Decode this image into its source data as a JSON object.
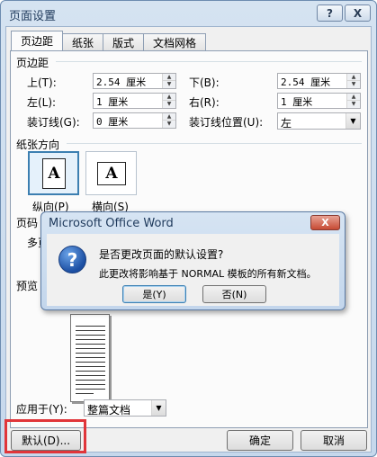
{
  "window": {
    "title": "页面设置",
    "help_label": "?",
    "close_label": "X"
  },
  "tabs": [
    {
      "label": "页边距",
      "active": true
    },
    {
      "label": "纸张",
      "active": false
    },
    {
      "label": "版式",
      "active": false
    },
    {
      "label": "文档网格",
      "active": false
    }
  ],
  "margins": {
    "section_label": "页边距",
    "top": {
      "label": "上(T):",
      "value": "2.54 厘米"
    },
    "bottom": {
      "label": "下(B):",
      "value": "2.54 厘米"
    },
    "left": {
      "label": "左(L):",
      "value": "1 厘米"
    },
    "right": {
      "label": "右(R):",
      "value": "1 厘米"
    },
    "gutter": {
      "label": "装订线(G):",
      "value": "0 厘米"
    },
    "gutter_pos": {
      "label": "装订线位置(U):",
      "value": "左"
    }
  },
  "orientation": {
    "section_label": "纸张方向",
    "portrait_label": "纵向(P)",
    "landscape_label": "横向(S)",
    "glyph": "A",
    "selected": "portrait"
  },
  "pages": {
    "section_label": "页码",
    "multi_label": "多页"
  },
  "preview": {
    "section_label": "预览",
    "apply_label": "应用于(Y):",
    "apply_value": "整篇文档"
  },
  "buttons": {
    "default_label": "默认(D)...",
    "ok_label": "确定",
    "cancel_label": "取消"
  },
  "dialog": {
    "title": "Microsoft Office Word",
    "close_label": "X",
    "icon_glyph": "?",
    "question": "是否更改页面的默认设置?",
    "detail": "此更改将影响基于 NORMAL 模板的所有新文档。",
    "yes_label": "是(Y)",
    "no_label": "否(N)"
  },
  "colors": {
    "accent": "#3c7fb1",
    "highlight": "#e0353a"
  }
}
